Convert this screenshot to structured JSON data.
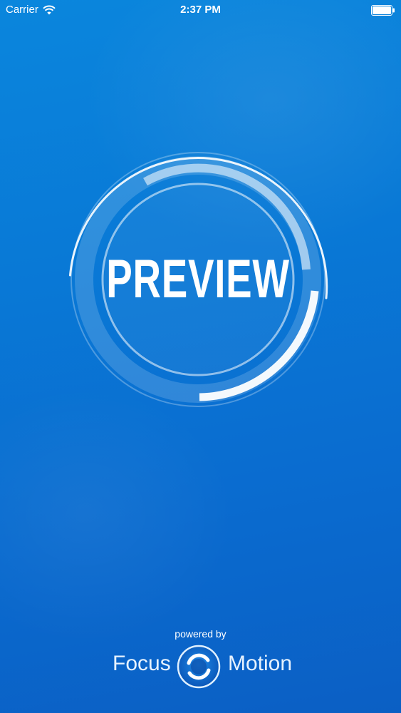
{
  "status_bar": {
    "carrier": "Carrier",
    "time": "2:37 PM",
    "wifi_icon": "wifi-icon",
    "battery_icon": "battery-icon"
  },
  "splash": {
    "title": "PREVIEW",
    "ring_icon": "progress-ring-icon"
  },
  "footer": {
    "powered_by": "powered by",
    "brand_left": "Focus",
    "brand_right": "Motion",
    "logo_icon": "focus-motion-logo-icon"
  },
  "colors": {
    "background_top": "#0a86dd",
    "background_bottom": "#0b5fc4",
    "text": "#ffffff"
  }
}
